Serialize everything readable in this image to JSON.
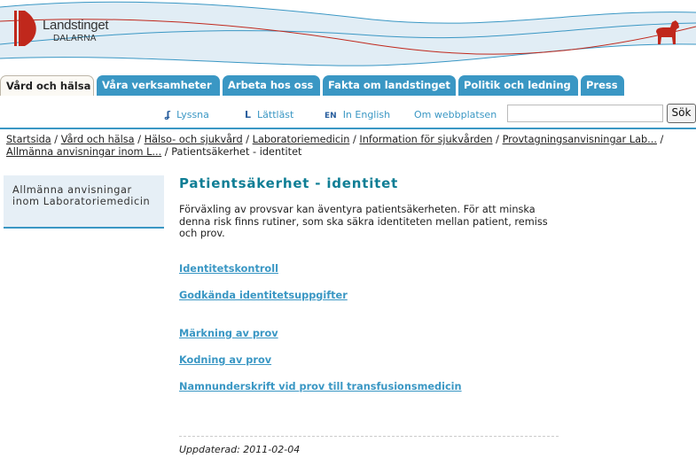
{
  "brand": {
    "name": "Landstinget",
    "sub": "DALARNA"
  },
  "colors": {
    "accent": "#3a97c4",
    "heading": "#0f7e95",
    "logo_red": "#c0281c",
    "banner_fill": "#e1edf5"
  },
  "tabs": [
    {
      "label": "Vård och hälsa",
      "active": true
    },
    {
      "label": "Våra verksamheter"
    },
    {
      "label": "Arbeta hos oss"
    },
    {
      "label": "Fakta om landstinget"
    },
    {
      "label": "Politik och ledning"
    },
    {
      "label": "Press"
    }
  ],
  "toolbar": {
    "listen": {
      "icon": "ear-icon",
      "label": "Lyssna"
    },
    "easy_read": {
      "icon": "easy-read-icon",
      "label": "Lättläst"
    },
    "english": {
      "icon": "EN",
      "label": "In English"
    },
    "about": {
      "label": "Om webbplatsen"
    },
    "search_value": "",
    "search_button": "Sök"
  },
  "breadcrumb": [
    "Startsida",
    "Vård och hälsa",
    "Hälso- och sjukvård",
    "Laboratoriemedicin",
    "Information för sjukvården",
    "Provtagningsanvisningar Lab...",
    "Allmänna anvisningar inom L..."
  ],
  "breadcrumb_current": "Patientsäkerhet - identitet",
  "sidenav": {
    "item": "Allmänna anvisningar inom Laboratoriemedicin"
  },
  "main": {
    "title": "Patientsäkerhet - identitet",
    "intro": "Förväxling av provsvar kan äventyra patientsäkerheten. För att minska denna risk finns rutiner, som ska säkra identiteten mellan patient, remiss och prov.",
    "links": [
      "Identitetskontroll",
      "Godkända identitetsuppgifter",
      "Märkning av prov",
      "Kodning av prov",
      "Namnunderskrift vid prov till transfusionsmedicin"
    ]
  },
  "footer": {
    "updated": "Uppdaterad: 2011-02-04"
  }
}
